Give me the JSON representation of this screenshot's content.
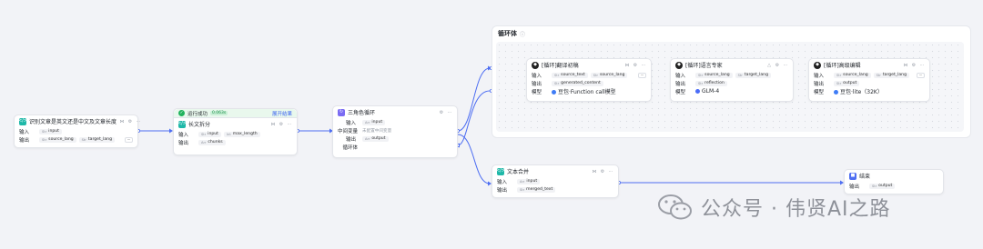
{
  "colors": {
    "wire": "#4e6ef2",
    "canvas": "#f2f3f7",
    "success": "#22b35e",
    "link": "#3a63f0"
  },
  "labels": {
    "input": "输入",
    "output": "输出",
    "model": "模型",
    "mid": "中间变量",
    "loop": "循环体"
  },
  "nodes": {
    "identify": {
      "title": "识别文章是英文还是中文及文章长度",
      "icon": "code-icon",
      "input_tags": [
        "input"
      ],
      "output_tags": [
        "source_lang",
        "target_lang"
      ],
      "output_more": "···"
    },
    "split": {
      "status_text": "运行成功",
      "duration": "0.063s",
      "expand_label": "展开结果",
      "title": "长文拆分",
      "icon": "code-icon",
      "input_tags": [
        "input",
        "max_length"
      ],
      "output_tags": [
        "chunks"
      ]
    },
    "tri_loop": {
      "title": "三角色循环",
      "icon": "loop-icon",
      "input_tags": [
        "input"
      ],
      "mid_placeholder": "未配置中间变量",
      "output_tags": [
        "output"
      ],
      "loop_label": "循环体"
    },
    "loop_body": {
      "title": "循环体",
      "info": "ⓘ"
    },
    "translate": {
      "title": "[循环]翻译初稿",
      "icon": "llm-icon",
      "input_tags": [
        "source_text",
        "source_lang"
      ],
      "output_tags": [
        "generated_content"
      ],
      "model": "豆包·Function call模型"
    },
    "expert": {
      "title": "[循环]语言专家",
      "icon": "llm-icon",
      "input_tags": [
        "source_lang",
        "target_lang"
      ],
      "output_tags": [
        "reflection"
      ],
      "model": "GLM-4"
    },
    "editor": {
      "title": "[循环]高级编辑",
      "icon": "llm-icon",
      "input_tags": [
        "source_lang",
        "target_lang"
      ],
      "output_tags": [
        "output"
      ],
      "model": "豆包·lite（32K）"
    },
    "merge": {
      "title": "文本合并",
      "icon": "code-icon",
      "input_tags": [
        "input"
      ],
      "output_tags": [
        "merged_text"
      ]
    },
    "end": {
      "title": "结束",
      "icon": "end-icon",
      "output_tags": [
        "output"
      ]
    }
  },
  "watermark": {
    "text": "公众号 · 伟贤AI之路"
  }
}
